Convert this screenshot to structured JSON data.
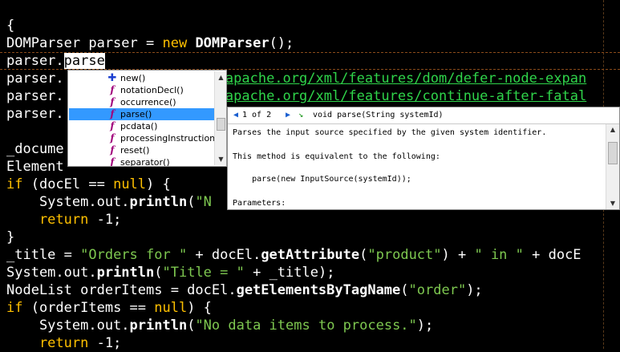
{
  "code": {
    "l0": "{",
    "l1": {
      "a": "DOMParser parser = ",
      "kw": "new",
      "b": " ",
      "cls": "DOMParser",
      "c": "();"
    },
    "l2": {
      "a": "parser.",
      "sel": "parse"
    },
    "l3": {
      "a": "parser.",
      "url": "/apache.org/xml/features/dom/defer-node-expan"
    },
    "l4": {
      "a": "parser.",
      "url": "/apache.org/xml/features/continue-after-fatal"
    },
    "l5": "parser.",
    "l7": "_docume",
    "l8": "Element",
    "l9": {
      "kw": "if",
      "a": " (docEl == ",
      "nul": "null",
      "b": ") {"
    },
    "l10": {
      "a": "    System.out.",
      "m": "println",
      "b": "(",
      "s": "\"N"
    },
    "l11": {
      "kw": "    return",
      "a": " -1;"
    },
    "l12": "}",
    "l13": {
      "a": "_title = ",
      "s1": "\"Orders for \"",
      "b": " + docEl.",
      "m": "getAttribute",
      "c": "(",
      "s2": "\"product\"",
      "d": ") + ",
      "s3": "\" in \"",
      "e": " + docE"
    },
    "l14": {
      "a": "System.out.",
      "m": "println",
      "b": "(",
      "s": "\"Title = \"",
      "c": " + _title);"
    },
    "l15": {
      "a": "NodeList orderItems = docEl.",
      "m": "getElementsByTagName",
      "b": "(",
      "s": "\"order\"",
      "c": ");"
    },
    "l16": {
      "kw": "if",
      "a": " (orderItems == ",
      "nul": "null",
      "b": ") {"
    },
    "l17": {
      "a": "    System.out.",
      "m": "println",
      "b": "(",
      "s": "\"No data items to process.\"",
      "c": ");"
    },
    "l18": {
      "kw": "    return",
      "a": " -1;"
    }
  },
  "completion": {
    "items": [
      {
        "icon": "plus-icon",
        "label": "new()"
      },
      {
        "icon": "function-icon",
        "label": "notationDecl()"
      },
      {
        "icon": "function-icon",
        "label": "occurrence()"
      },
      {
        "icon": "function-icon",
        "label": "parse()"
      },
      {
        "icon": "function-icon",
        "label": "pcdata()"
      },
      {
        "icon": "function-icon",
        "label": "processingInstruction()"
      },
      {
        "icon": "function-icon",
        "label": "reset()"
      },
      {
        "icon": "function-icon",
        "label": "separator()"
      }
    ],
    "selected_index": 3
  },
  "doc": {
    "pager": "1 of 2",
    "return_type": "void",
    "signature": "parse(String systemId)",
    "lines": [
      "Parses the input source specified by the given system identifier.",
      "This method is equivalent to the following:",
      "    parse(new InputSource(systemId));",
      "Parameters:"
    ]
  },
  "colors": {
    "keyword": "#ffc000",
    "string": "#7ec850",
    "selection": "#3399ff"
  }
}
